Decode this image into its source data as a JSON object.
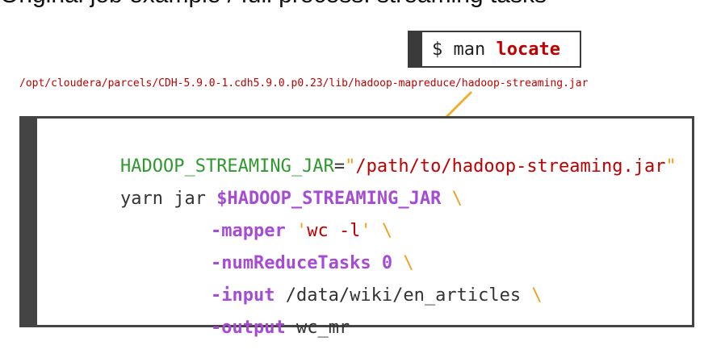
{
  "heading": "Original job example / full process: streaming tasks",
  "man_command": {
    "prompt": "$ man ",
    "keyword": "locate"
  },
  "jar_path": "/opt/cloudera/parcels/CDH-5.9.0-1.cdh5.9.0.p0.23/lib/hadoop-mapreduce/hadoop-streaming.jar",
  "code": {
    "line1": {
      "var": "HADOOP_STREAMING_JAR",
      "eq": "=",
      "q1": "\"",
      "value": "/path/to/hadoop-streaming.jar",
      "q2": "\""
    },
    "line2": {
      "cmd": "yarn jar ",
      "var": "$HADOOP_STREAMING_JAR",
      "cont": " \\"
    },
    "line3": {
      "flag": "-mapper ",
      "q1": "'",
      "value": "wc -l",
      "q2": "'",
      "cont": " \\"
    },
    "line4": {
      "flag": "-numReduceTasks ",
      "value": "0",
      "cont": " \\"
    },
    "line5": {
      "flag": "-input ",
      "value": "/data/wiki/en_articles",
      "cont": " \\"
    },
    "line6": {
      "flag": "-output ",
      "value": "wc_mr"
    }
  },
  "colors": {
    "accent": "#c00000",
    "var": "#2e9a2e",
    "flag": "#a64bd6",
    "cont": "#f0a020",
    "arrow": "#f0b030"
  }
}
